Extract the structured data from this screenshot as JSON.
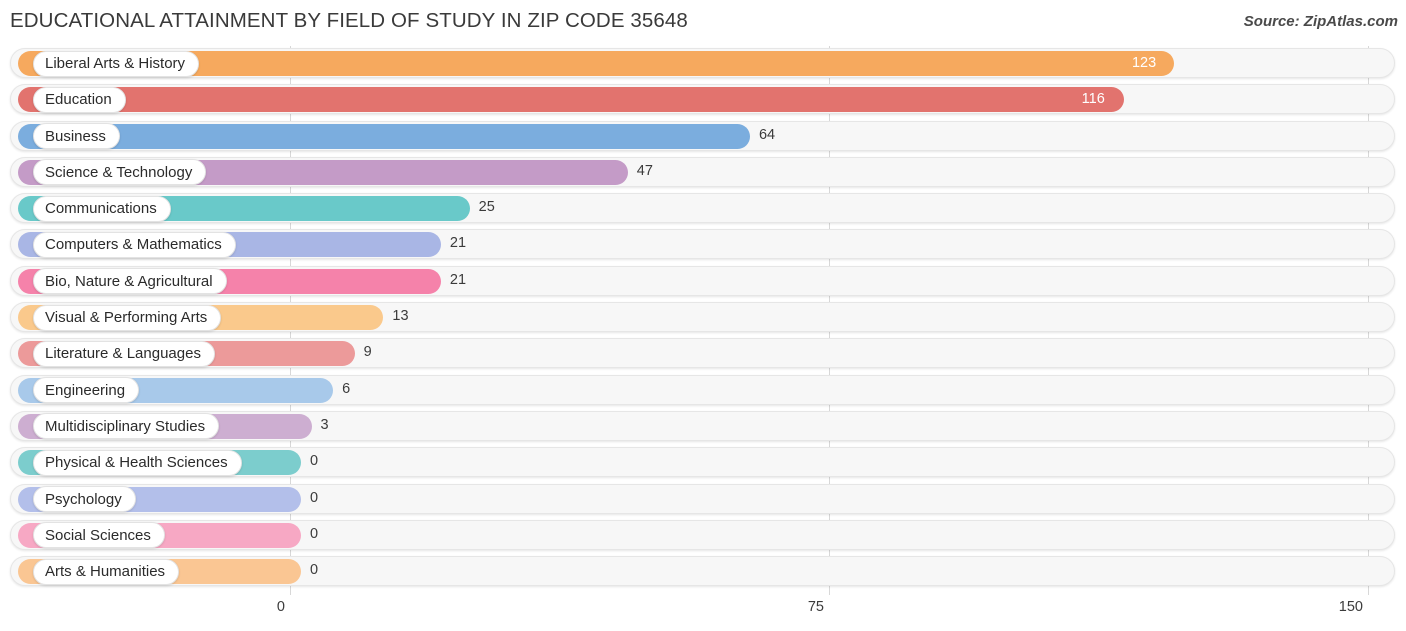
{
  "header": {
    "title": "EDUCATIONAL ATTAINMENT BY FIELD OF STUDY IN ZIP CODE 35648",
    "source": "Source: ZipAtlas.com"
  },
  "chart_data": {
    "type": "bar",
    "orientation": "horizontal",
    "title": "EDUCATIONAL ATTAINMENT BY FIELD OF STUDY IN ZIP CODE 35648",
    "subtitle": "",
    "xlabel": "",
    "ylabel": "",
    "xlim": [
      0,
      150
    ],
    "xticks": [
      0,
      75,
      150
    ],
    "xtick_labels": [
      "0",
      "75",
      "150"
    ],
    "grid": true,
    "legend": false,
    "categories": [
      "Liberal Arts & History",
      "Education",
      "Business",
      "Science & Technology",
      "Communications",
      "Computers & Mathematics",
      "Bio, Nature & Agricultural",
      "Visual & Performing Arts",
      "Literature & Languages",
      "Engineering",
      "Multidisciplinary Studies",
      "Physical & Health Sciences",
      "Psychology",
      "Social Sciences",
      "Arts & Humanities"
    ],
    "values": [
      123,
      116,
      64,
      47,
      25,
      21,
      21,
      13,
      9,
      6,
      3,
      0,
      0,
      0,
      0
    ],
    "value_labels": [
      "123",
      "116",
      "64",
      "47",
      "25",
      "21",
      "21",
      "13",
      "9",
      "6",
      "3",
      "0",
      "0",
      "0",
      "0"
    ],
    "colors": [
      "#f6a95e",
      "#e2736e",
      "#7badde",
      "#c49bc7",
      "#69c9c9",
      "#a9b6e5",
      "#f582aa",
      "#fac98c",
      "#ec9a9a",
      "#a8c9ea",
      "#cdaed1",
      "#7ccdcd",
      "#b3bfea",
      "#f7a8c4",
      "#fac693"
    ]
  }
}
